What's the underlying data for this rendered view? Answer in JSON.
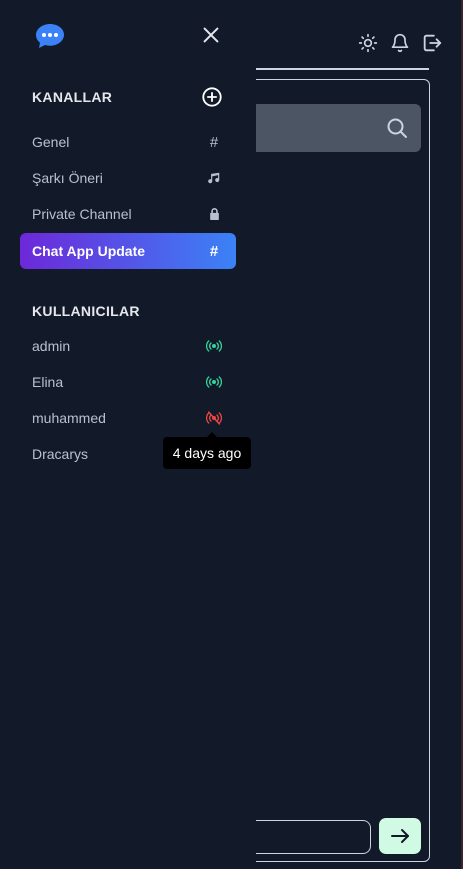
{
  "drawer": {
    "channels_title": "KANALLAR",
    "users_title": "KULLANICILAR",
    "channels": [
      {
        "label": "Genel",
        "icon": "hash-icon"
      },
      {
        "label": "Şarkı Öneri",
        "icon": "music-icon"
      },
      {
        "label": "Private Channel",
        "icon": "lock-icon"
      },
      {
        "label": "Chat App Update",
        "icon": "hash-icon",
        "active": true
      }
    ],
    "users": [
      {
        "name": "admin",
        "status": "online"
      },
      {
        "name": "Elina",
        "status": "online"
      },
      {
        "name": "muhammed",
        "status": "offline"
      },
      {
        "name": "Dracarys",
        "status": "none"
      }
    ],
    "tooltip": "4 days ago"
  },
  "colors": {
    "background": "#121a2a",
    "accent_start": "#6d28d9",
    "accent_end": "#3b82f6",
    "online": "#34d399",
    "offline": "#ef4444",
    "logo": "#3b82f6",
    "send_bg": "#d1fae5"
  },
  "icons": [
    "chat-bubble-icon",
    "close-icon",
    "plus-circle-icon",
    "sun-icon",
    "bell-icon",
    "logout-icon",
    "search-icon",
    "arrow-right-icon"
  ]
}
